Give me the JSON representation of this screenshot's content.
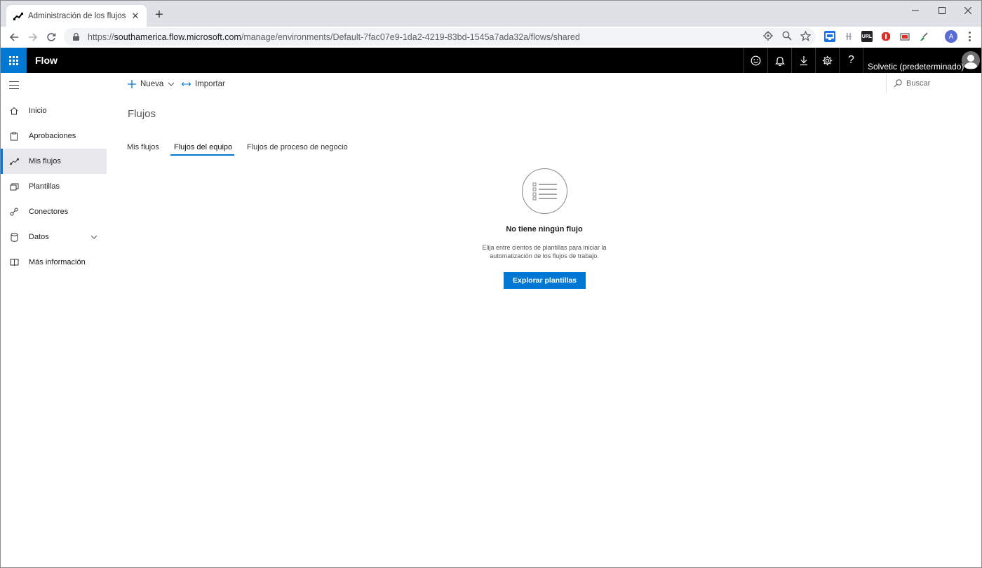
{
  "browser": {
    "tab_title": "Administración de los flujos | Mi",
    "url_scheme": "https://",
    "url_host": "southamerica.flow.microsoft.com",
    "url_path": "/manage/environments/Default-7fac07e9-1da2-4219-83bd-1545a7ada32a/flows/shared",
    "profile_initial": "A",
    "extensions": [
      "pinned-monitor-ext",
      "clip-ext",
      "url-ext",
      "red-ext",
      "screenshot-ext",
      "broom-ext"
    ]
  },
  "appbar": {
    "brand": "Flow",
    "environment": "Solvetic (predeterminado)",
    "help_glyph": "?",
    "accent": "#0078d4"
  },
  "commands": {
    "new_label": "Nueva",
    "import_label": "Importar",
    "search_label": "Buscar"
  },
  "nav": {
    "items": [
      {
        "label": "Inicio",
        "icon": "home-icon"
      },
      {
        "label": "Aprobaciones",
        "icon": "approvals-icon"
      },
      {
        "label": "Mis flujos",
        "icon": "flows-icon"
      },
      {
        "label": "Plantillas",
        "icon": "templates-icon"
      },
      {
        "label": "Conectores",
        "icon": "connectors-icon"
      },
      {
        "label": "Datos",
        "icon": "data-icon"
      },
      {
        "label": "Más información",
        "icon": "book-icon"
      }
    ],
    "active": "Mis flujos"
  },
  "main": {
    "title": "Flujos",
    "tabs": [
      {
        "label": "Mis flujos"
      },
      {
        "label": "Flujos del equipo"
      },
      {
        "label": "Flujos de proceso de negocio"
      }
    ],
    "active_tab": "Flujos del equipo",
    "empty": {
      "title": "No tiene ningún flujo",
      "desc_line1": "Elija entre cientos de plantillas para iniciar la",
      "desc_line2": "automatización de los flujos de trabajo.",
      "button": "Explorar plantillas"
    }
  }
}
